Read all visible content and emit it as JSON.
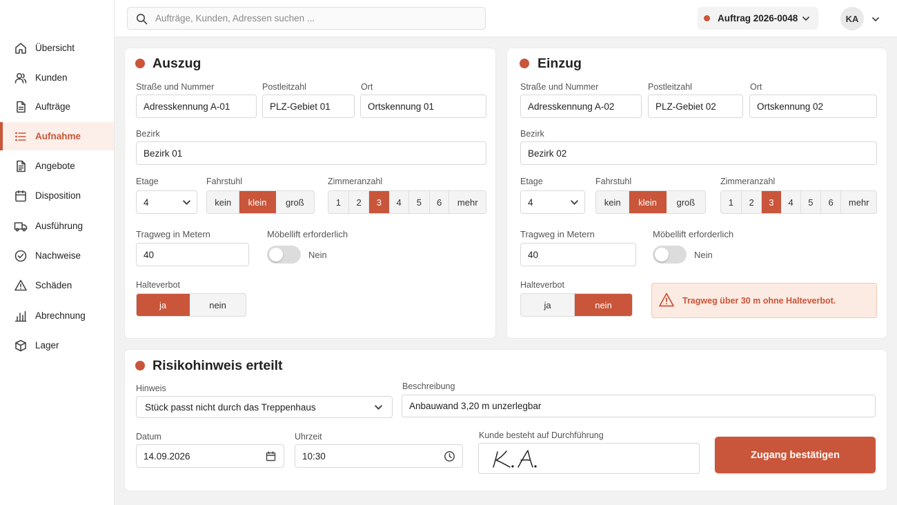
{
  "colors": {
    "accent": "#c9553a",
    "accent_light": "#fcefe9",
    "warning_bg": "#fcebe2"
  },
  "sidebar": {
    "items": [
      {
        "label": "Übersicht",
        "icon": "home-icon"
      },
      {
        "label": "Kunden",
        "icon": "users-icon"
      },
      {
        "label": "Aufträge",
        "icon": "document-icon"
      },
      {
        "label": "Aufnahme",
        "icon": "list-icon",
        "active": true
      },
      {
        "label": "Angebote",
        "icon": "document-text-icon"
      },
      {
        "label": "Disposition",
        "icon": "calendar-icon"
      },
      {
        "label": "Ausführung",
        "icon": "truck-icon"
      },
      {
        "label": "Nachweise",
        "icon": "check-circle-icon"
      },
      {
        "label": "Schäden",
        "icon": "warning-icon"
      },
      {
        "label": "Abrechnung",
        "icon": "bar-chart-icon"
      },
      {
        "label": "Lager",
        "icon": "box-icon"
      }
    ]
  },
  "header": {
    "search_placeholder": "Aufträge, Kunden, Adressen suchen ...",
    "order": "Auftrag 2026-0048",
    "avatar": "KA"
  },
  "auszug": {
    "title": "Auszug",
    "labels": {
      "street": "Straße und Nummer",
      "zip": "Postleitzahl",
      "city": "Ort",
      "district": "Bezirk",
      "floor": "Etage",
      "elevator": "Fahrstuhl",
      "rooms": "Zimmeranzahl",
      "carry": "Tragweg in Metern",
      "lift": "Möbellift erforderlich",
      "noparking": "Halteverbot"
    },
    "street": "Adresskennung A-01",
    "zip": "PLZ-Gebiet 01",
    "city": "Ortskennung 01",
    "district": "Bezirk 01",
    "floor": "4",
    "elevator_options": [
      "kein",
      "klein",
      "groß"
    ],
    "elevator_selected": "klein",
    "room_options": [
      "1",
      "2",
      "3",
      "4",
      "5",
      "6",
      "mehr"
    ],
    "rooms_selected": "3",
    "carry_distance": "40",
    "lift_state": "Nein",
    "noparking_options": [
      "ja",
      "nein"
    ],
    "noparking_selected": "ja"
  },
  "einzug": {
    "title": "Einzug",
    "labels": {
      "street": "Straße und Nummer",
      "zip": "Postleitzahl",
      "city": "Ort",
      "district": "Bezirk",
      "floor": "Etage",
      "elevator": "Fahrstuhl",
      "rooms": "Zimmeranzahl",
      "carry": "Tragweg in Metern",
      "lift": "Möbellift erforderlich",
      "noparking": "Halteverbot"
    },
    "street": "Adresskennung A-02",
    "zip": "PLZ-Gebiet 02",
    "city": "Ortskennung 02",
    "district": "Bezirk 02",
    "floor": "4",
    "elevator_options": [
      "kein",
      "klein",
      "groß"
    ],
    "elevator_selected": "klein",
    "room_options": [
      "1",
      "2",
      "3",
      "4",
      "5",
      "6",
      "mehr"
    ],
    "rooms_selected": "3",
    "carry_distance": "40",
    "lift_state": "Nein",
    "noparking_options": [
      "ja",
      "nein"
    ],
    "noparking_selected": "nein",
    "warning": "Tragweg über 30 m ohne Halteverbot."
  },
  "risk": {
    "title": "Risikohinweis erteilt",
    "labels": {
      "hint": "Hinweis",
      "description": "Beschreibung",
      "date": "Datum",
      "time": "Uhrzeit",
      "customer": "Kunde besteht auf Durchführung"
    },
    "hint": "Stück passt nicht durch das Treppenhaus",
    "description": "Anbauwand 3,20 m unzerlegbar",
    "date": "14.09.2026",
    "time": "10:30",
    "confirm_label": "Zugang bestätigen"
  }
}
